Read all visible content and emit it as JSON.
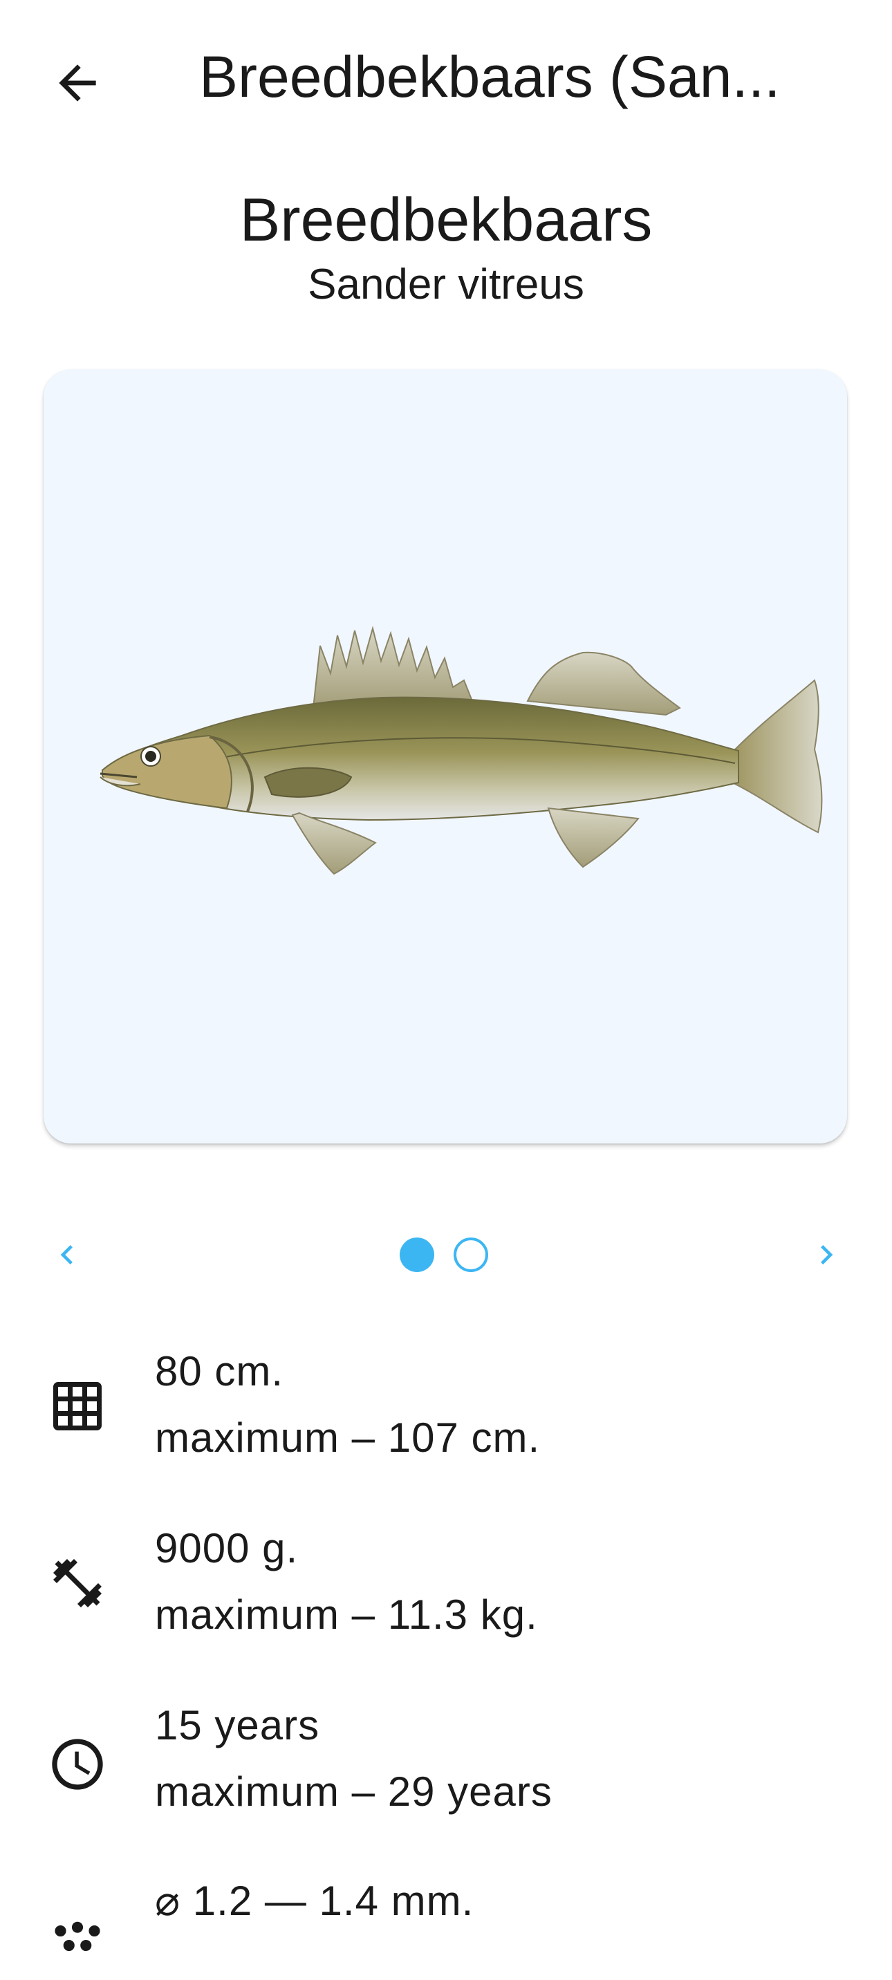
{
  "app_bar": {
    "back_icon": "arrow-left-icon",
    "title": "Breedbekbaars (San..."
  },
  "species": {
    "common_name": "Breedbekbaars",
    "latin_name": "Sander vitreus"
  },
  "gallery": {
    "image_subject": "fish-illustration",
    "prev_icon": "chevron-left-icon",
    "next_icon": "chevron-right-icon",
    "page_count": 2,
    "current_page": 1,
    "accent_color": "#3cb6f3",
    "card_background": "#f1f7fe"
  },
  "stats": [
    {
      "icon": "grid-icon",
      "value": "80 cm.",
      "maximum": "maximum – 107 cm."
    },
    {
      "icon": "dumbbell-icon",
      "value": "9000 g.",
      "maximum": "maximum – 11.3 kg."
    },
    {
      "icon": "clock-icon",
      "value": "15 years",
      "maximum": "maximum – 29 years"
    },
    {
      "icon": "eggs-icon",
      "value": "⌀ 1.2 — 1.4 mm."
    }
  ]
}
